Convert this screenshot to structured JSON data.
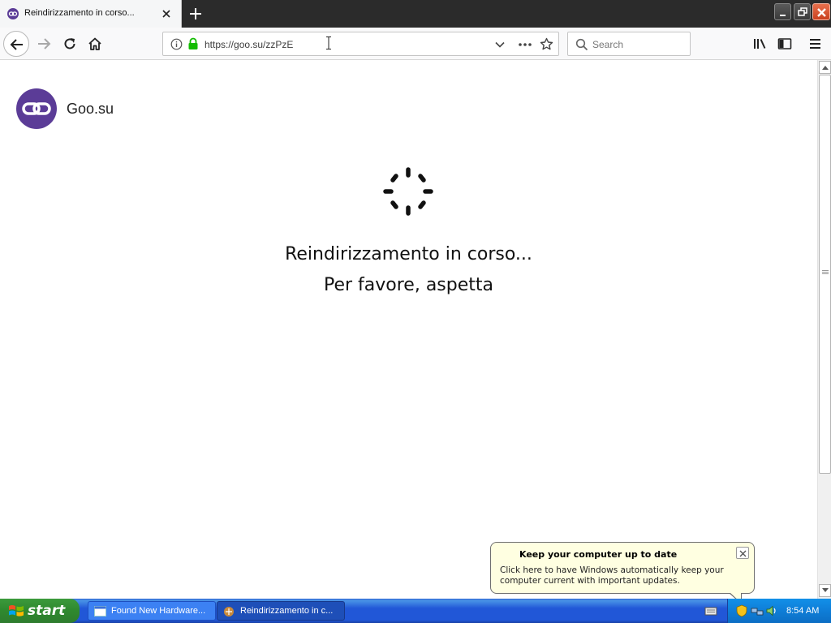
{
  "browser": {
    "tab": {
      "title": "Reindirizzamento in corso..."
    },
    "url": "https://goo.su/zzPzE",
    "search": {
      "placeholder": "Search"
    }
  },
  "page": {
    "brand": "Goo.su",
    "message_line1": "Reindirizzamento in corso...",
    "message_line2": "Per favore, aspetta"
  },
  "notification": {
    "title": "Keep your computer up to date",
    "body": "Click here to have Windows automatically keep your computer current with important updates."
  },
  "taskbar": {
    "start_label": "start",
    "tasks": [
      {
        "label": "Found New Hardware..."
      },
      {
        "label": "Reindirizzamento in c..."
      }
    ],
    "clock": "8:54 AM"
  },
  "colors": {
    "logo_purple": "#5b3c97",
    "lock_green": "#12bc00",
    "taskbar_blue": "#2157d7",
    "start_green": "#2f8a2f",
    "balloon_yellow": "#ffffe1"
  }
}
